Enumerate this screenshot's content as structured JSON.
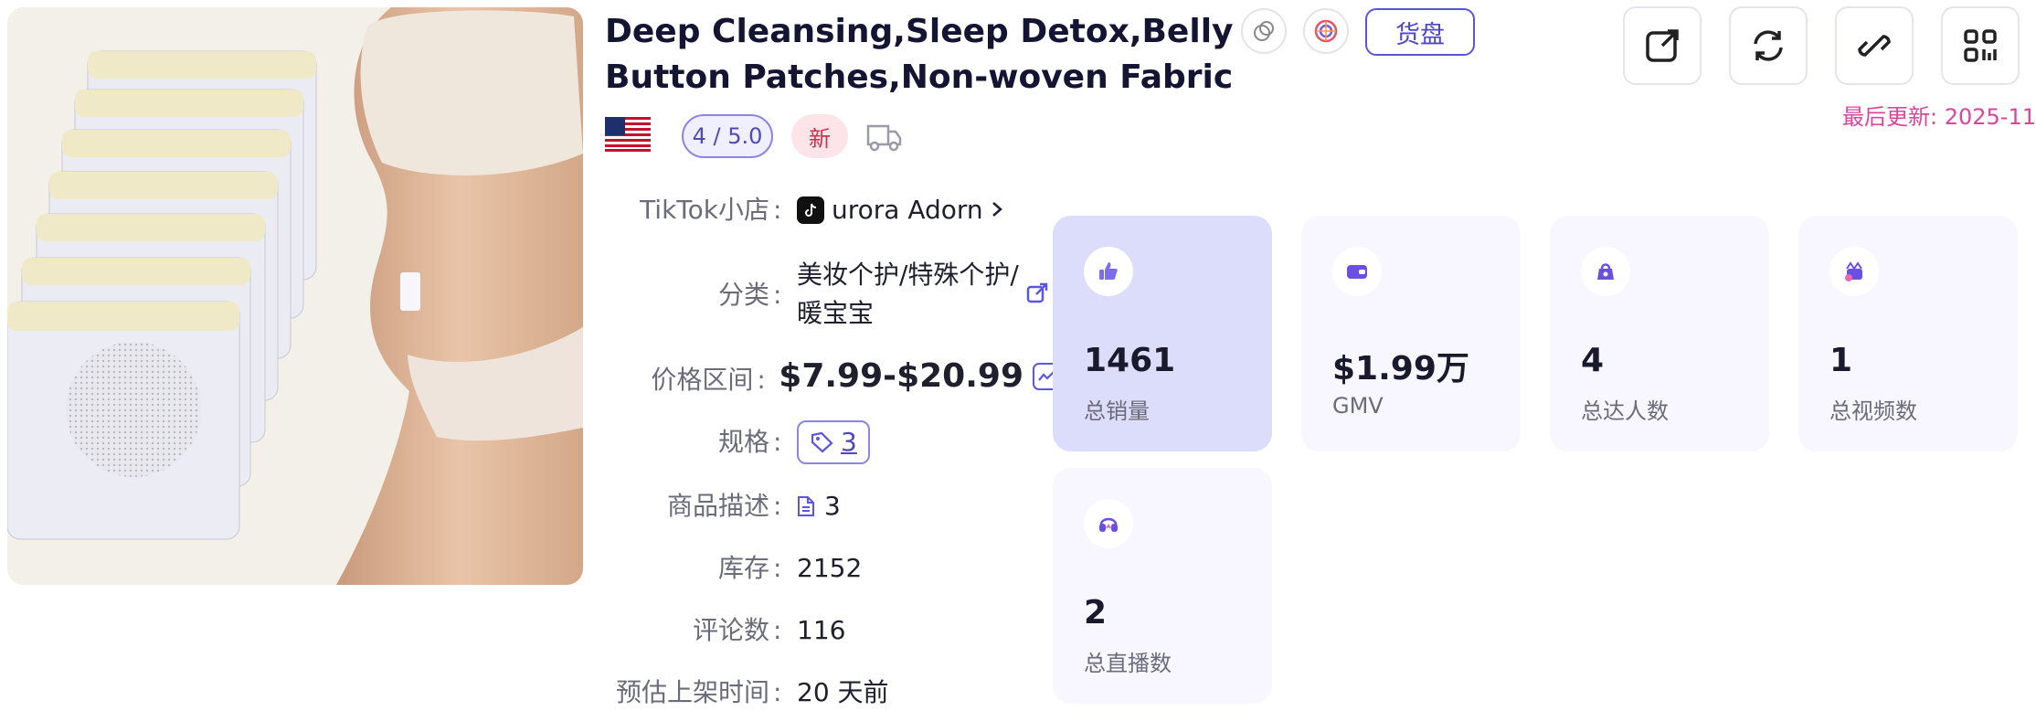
{
  "product": {
    "title_line1": "Deep Cleansing,Sleep Detox,Belly",
    "title_line2": "Button Patches,Non-woven Fabric Bel...",
    "tag_button": "货盘",
    "updated": "最后更新: 2025-11",
    "rating": "4 / 5.0",
    "new_badge": "新"
  },
  "info": {
    "shop_label": "TikTok小店",
    "shop_name": "urora Adorn",
    "category_label": "分类",
    "category_line1": "美妆个护/特殊个护/",
    "category_line2": "暖宝宝",
    "price_label": "价格区间",
    "price": "$7.99-$20.99",
    "spec_label": "规格",
    "spec_count": "3",
    "desc_label": "商品描述",
    "desc_count": "3",
    "stock_label": "库存",
    "stock": "2152",
    "reviews_label": "评论数",
    "reviews": "116",
    "listed_label": "预估上架时间",
    "listed": "20 天前",
    "colon": ":"
  },
  "stats": [
    {
      "value": "1461",
      "label": "总销量",
      "icon": "thumbs-up-icon"
    },
    {
      "value": "$1.99万",
      "label": "GMV",
      "icon": "wallet-icon"
    },
    {
      "value": "4",
      "label": "总达人数",
      "icon": "influencer-icon"
    },
    {
      "value": "1",
      "label": "总视频数",
      "icon": "video-icon"
    },
    {
      "value": "2",
      "label": "总直播数",
      "icon": "live-icon"
    }
  ],
  "colors": {
    "accent": "#5b55e0",
    "price": "#d9479c",
    "active_card": "#dcdcfb",
    "card": "#f8f7ff"
  }
}
